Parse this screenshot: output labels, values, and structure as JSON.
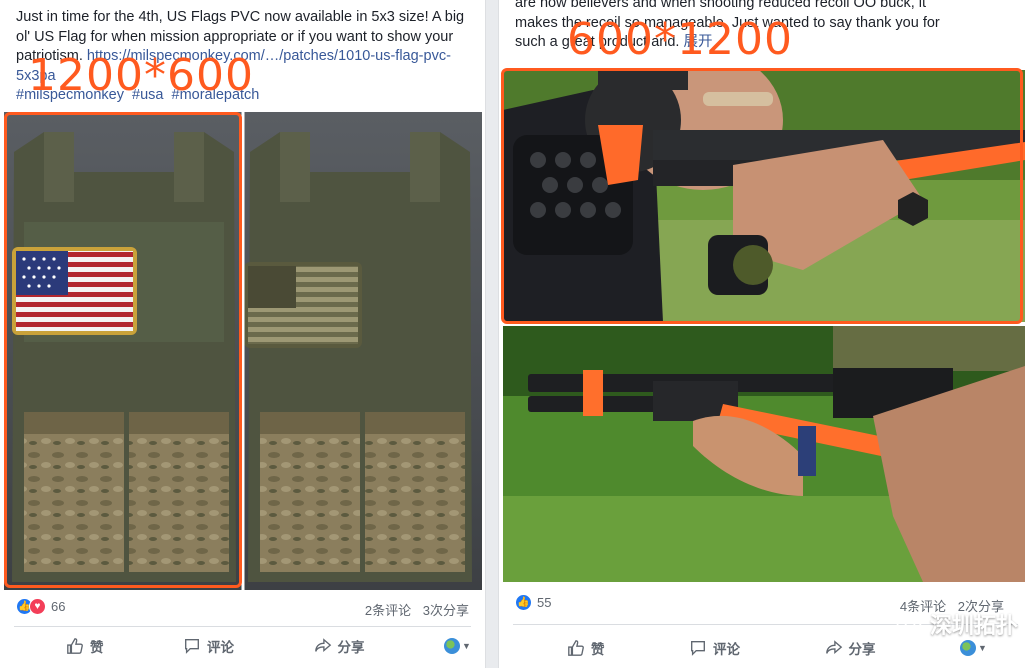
{
  "left_post": {
    "text_lines": [
      "Just in time for the 4th, US Flags PVC now available in 5x3 size! A big",
      "ol' US Flag for when mission appropriate or if you want to show your",
      "patriotism."
    ],
    "link": "https://milspecmonkey.com/…/patches/1010-us-flag-pvc-",
    "link_tail": "5x3pa",
    "hashtags": [
      "#milspecmonkey",
      "#usa",
      "#moralepatch"
    ],
    "size_label": "1200*600",
    "reaction_count": "66",
    "comments": "2条评论",
    "shares": "3次分享",
    "actions": {
      "like": "赞",
      "comment": "评论",
      "share": "分享"
    }
  },
  "right_post": {
    "text_lines": [
      "are how believers and when shooting reduced recoil OO buck, it",
      "makes the recoil so manageable. Just wanted to say thank you for",
      "such a great product and."
    ],
    "more": "展开",
    "size_label": "600*1200",
    "reaction_count": "55",
    "comments": "4条评论",
    "shares": "2次分享",
    "actions": {
      "like": "赞",
      "comment": "评论",
      "share": "分享"
    }
  },
  "watermark": "深圳拓扑",
  "colors": {
    "highlight": "#ff5a1f",
    "link": "#385898",
    "like_blue": "#2078f4",
    "love_red": "#f33e58"
  },
  "icons": [
    "like-reaction-icon",
    "love-reaction-icon",
    "thumbs-up-icon",
    "comment-icon",
    "share-icon",
    "globe-icon",
    "caret-down-icon",
    "wechat-icon"
  ]
}
